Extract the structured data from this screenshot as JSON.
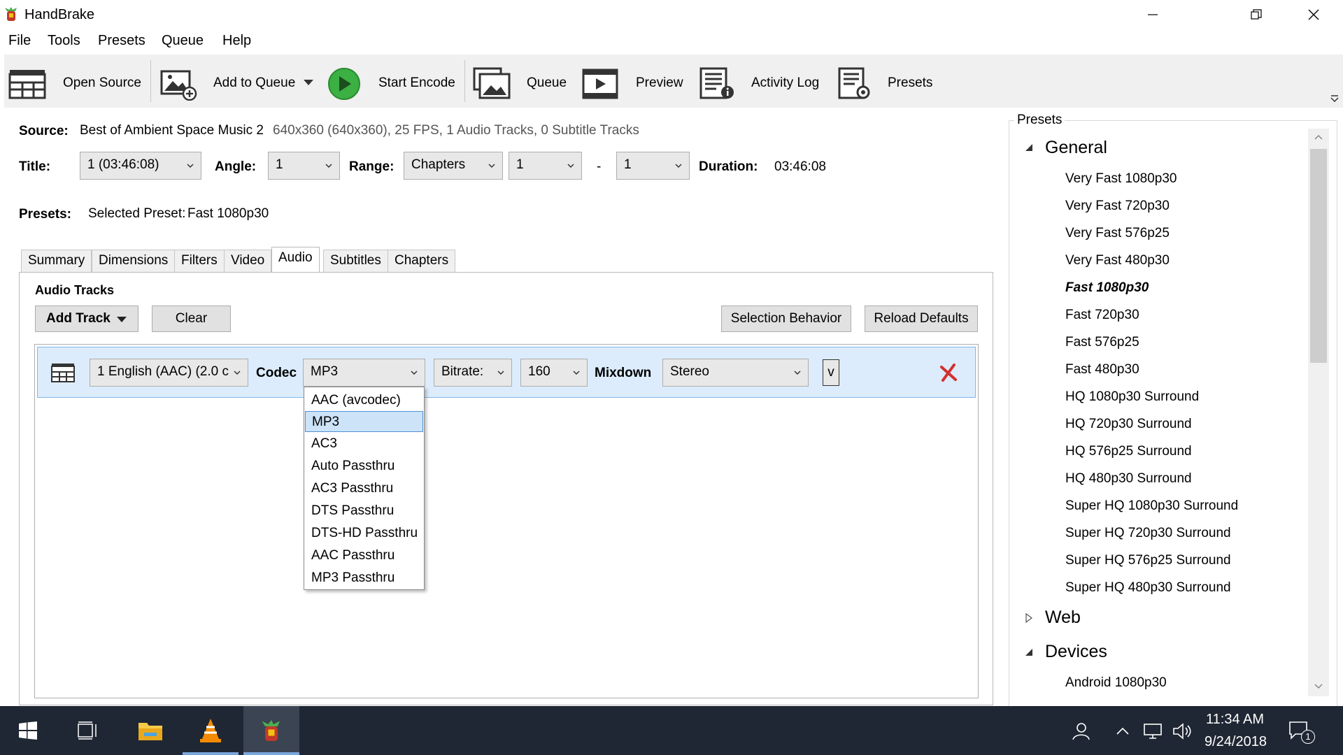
{
  "window": {
    "title": "HandBrake"
  },
  "menu": [
    "File",
    "Tools",
    "Presets",
    "Queue",
    "Help"
  ],
  "toolbar": {
    "open_source": "Open Source",
    "add_to_queue": "Add to Queue",
    "start_encode": "Start Encode",
    "queue": "Queue",
    "preview": "Preview",
    "activity_log": "Activity Log",
    "presets": "Presets"
  },
  "source": {
    "label": "Source:",
    "name": "Best of Ambient Space Music 2",
    "info": "640x360 (640x360), 25 FPS, 1 Audio Tracks, 0 Subtitle Tracks"
  },
  "title_row": {
    "title_label": "Title:",
    "title_value": "1 (03:46:08)",
    "angle_label": "Angle:",
    "angle_value": "1",
    "range_label": "Range:",
    "range_type": "Chapters",
    "range_start": "1",
    "range_dash": "-",
    "range_end": "1",
    "duration_label": "Duration:",
    "duration_value": "03:46:08"
  },
  "presets_row": {
    "label": "Presets:",
    "selected_label": "Selected Preset:",
    "selected_value": "Fast 1080p30"
  },
  "tabs": [
    "Summary",
    "Dimensions",
    "Filters",
    "Video",
    "Audio",
    "Subtitles",
    "Chapters"
  ],
  "active_tab": "Audio",
  "audio": {
    "heading": "Audio Tracks",
    "add_track": "Add Track",
    "clear": "Clear",
    "selection_behavior": "Selection Behavior",
    "reload_defaults": "Reload Defaults",
    "track": {
      "source": "1 English (AAC) (2.0 c",
      "codec_label": "Codec",
      "codec_value": "MP3",
      "bitrate_label": "Bitrate:",
      "bitrate_value": "160",
      "mixdown_label": "Mixdown",
      "mixdown_value": "Stereo",
      "expand_label": "v"
    },
    "codec_options": [
      "AAC (avcodec)",
      "MP3",
      "AC3",
      "Auto Passthru",
      "AC3 Passthru",
      "DTS Passthru",
      "DTS-HD Passthru",
      "AAC Passthru",
      "MP3 Passthru"
    ],
    "codec_selected": "MP3"
  },
  "presets_panel": {
    "title": "Presets",
    "categories": [
      {
        "name": "General",
        "expanded": true,
        "items": [
          "Very Fast 1080p30",
          "Very Fast 720p30",
          "Very Fast 576p25",
          "Very Fast 480p30",
          "Fast 1080p30",
          "Fast 720p30",
          "Fast 576p25",
          "Fast 480p30",
          "HQ 1080p30 Surround",
          "HQ 720p30 Surround",
          "HQ 576p25 Surround",
          "HQ 480p30 Surround",
          "Super HQ 1080p30 Surround",
          "Super HQ 720p30 Surround",
          "Super HQ 576p25 Surround",
          "Super HQ 480p30 Surround"
        ]
      },
      {
        "name": "Web",
        "expanded": false,
        "items": []
      },
      {
        "name": "Devices",
        "expanded": true,
        "items": [
          "Android 1080p30"
        ]
      }
    ],
    "selected_preset": "Fast 1080p30"
  },
  "taskbar": {
    "time": "11:34 AM",
    "date": "9/24/2018",
    "notification_count": "1"
  },
  "colors": {
    "toolbar_bg": "#f0f0f0",
    "selection_bg": "#dcecfc",
    "taskbar_bg": "#1f2734",
    "start_encode_green": "#3cb043",
    "remove_red": "#d32f2f"
  }
}
